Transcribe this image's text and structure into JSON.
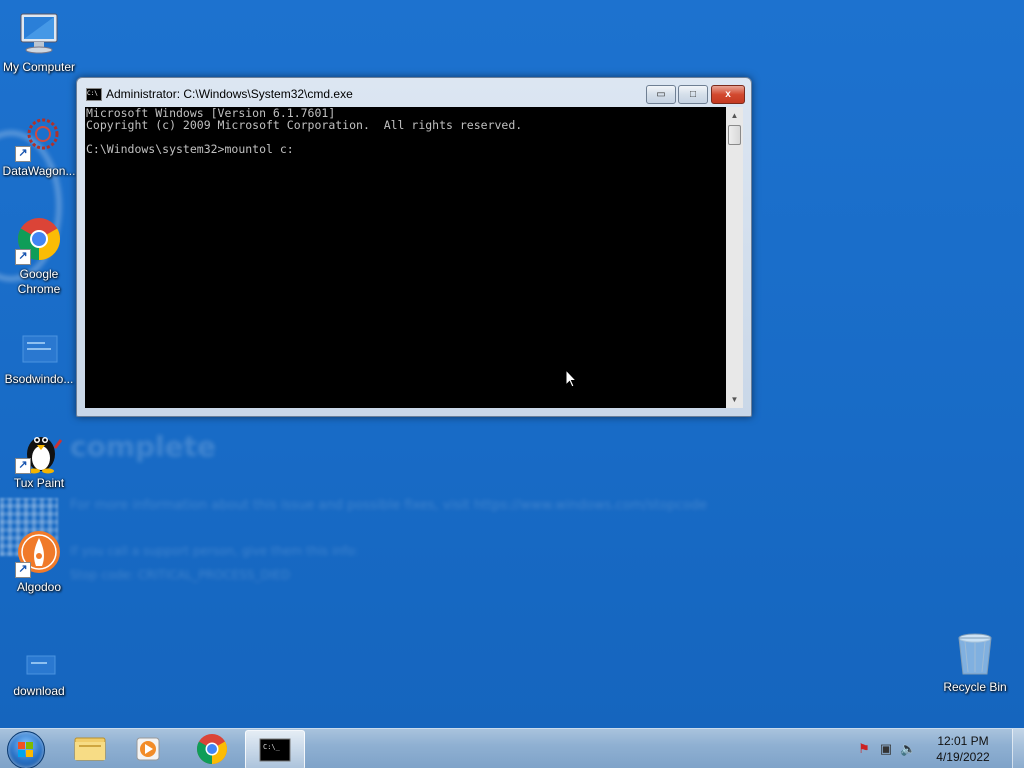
{
  "desktop": {
    "icons": [
      {
        "label": "My Computer",
        "icon": "computer-icon"
      },
      {
        "label": "DataWagon...",
        "icon": "datawagon-icon"
      },
      {
        "label": "Google Chrome",
        "icon": "chrome-icon"
      },
      {
        "label": "Bsodwindo...",
        "icon": "bsod-icon"
      },
      {
        "label": "Tux Paint",
        "icon": "tux-paint-icon"
      },
      {
        "label": "Algodoo",
        "icon": "algodoo-icon"
      },
      {
        "label": "download",
        "icon": "folder-icon"
      },
      {
        "label": "Recycle Bin",
        "icon": "recycle-bin-icon"
      }
    ],
    "wallpaper_ghost": {
      "headline": "complete",
      "line1": "For more information about this issue and possible fixes, visit https://www.windows.com/stopcode",
      "line2": "If you call a support person, give them this info:",
      "line3": "Stop code: CRITICAL_PROCESS_DIED"
    }
  },
  "cmd_window": {
    "title": "Administrator: C:\\Windows\\System32\\cmd.exe",
    "lines": [
      "Microsoft Windows [Version 6.1.7601]",
      "Copyright (c) 2009 Microsoft Corporation.  All rights reserved.",
      "",
      "C:\\Windows\\system32>mountol c:"
    ],
    "minimize": "▭",
    "maximize": "□",
    "close": "x"
  },
  "taskbar": {
    "pinned": [
      "explorer-icon",
      "media-player-icon",
      "chrome-icon",
      "cmd-icon"
    ],
    "active": "cmd-icon",
    "clock": {
      "time": "12:01 PM",
      "date": "4/19/2022"
    }
  },
  "colors": {
    "desktop": "#1a6fc9",
    "console_bg": "#000000",
    "console_fg": "#c0c0c0",
    "close_button": "#c43a22"
  }
}
